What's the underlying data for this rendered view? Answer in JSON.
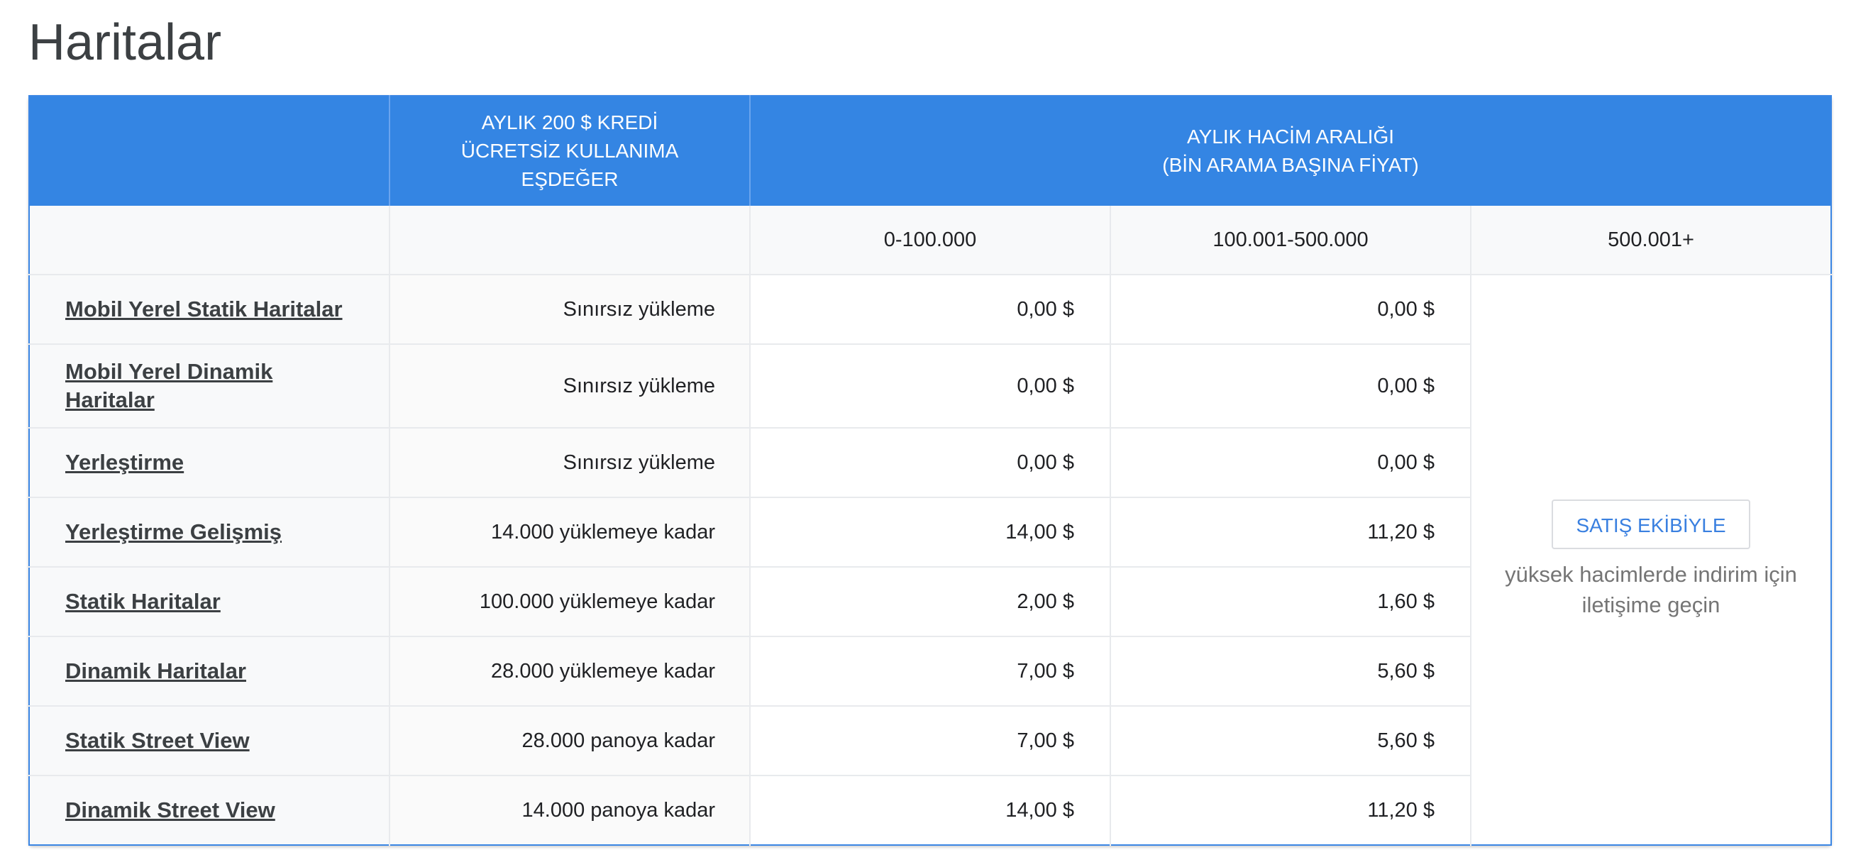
{
  "page_title": "Haritalar",
  "table": {
    "header": {
      "free_usage_lines": [
        "AYLIK 200 $ KREDİ",
        "ÜCRETSİZ KULLANIMA",
        "EŞDEĞER"
      ],
      "volume_lines": [
        "AYLIK HACİM ARALIĞI",
        "(BİN ARAMA BAŞINA FİYAT)"
      ]
    },
    "tiers": [
      "0-100.000",
      "100.001-500.000",
      "500.001+"
    ],
    "rows": [
      {
        "name": "Mobil Yerel Statik Haritalar",
        "free": "Sınırsız yükleme",
        "tier1": "0,00 $",
        "tier2": "0,00 $"
      },
      {
        "name": "Mobil Yerel Dinamik Haritalar",
        "free": "Sınırsız yükleme",
        "tier1": "0,00 $",
        "tier2": "0,00 $"
      },
      {
        "name": "Yerleştirme",
        "free": "Sınırsız yükleme",
        "tier1": "0,00 $",
        "tier2": "0,00 $"
      },
      {
        "name": "Yerleştirme Gelişmiş",
        "free": "14.000 yüklemeye kadar",
        "tier1": "14,00 $",
        "tier2": "11,20 $"
      },
      {
        "name": "Statik Haritalar",
        "free": "100.000 yüklemeye kadar",
        "tier1": "2,00 $",
        "tier2": "1,60 $"
      },
      {
        "name": "Dinamik Haritalar",
        "free": "28.000 yüklemeye kadar",
        "tier1": "7,00 $",
        "tier2": "5,60 $"
      },
      {
        "name": "Statik Street View",
        "free": "28.000 panoya kadar",
        "tier1": "7,00 $",
        "tier2": "5,60 $"
      },
      {
        "name": "Dinamik Street View",
        "free": "14.000 panoya kadar",
        "tier1": "14,00 $",
        "tier2": "11,20 $"
      }
    ],
    "sales": {
      "button_label": "SATIŞ EKİBİYLE",
      "note": "yüksek hacimlerde indirim için iletişime geçin"
    },
    "colors": {
      "header_bg": "#3485e3",
      "row_label_bg": "#f8f9fa",
      "link_text": "#3c4043",
      "sales_button_text": "#3a80e0"
    }
  }
}
